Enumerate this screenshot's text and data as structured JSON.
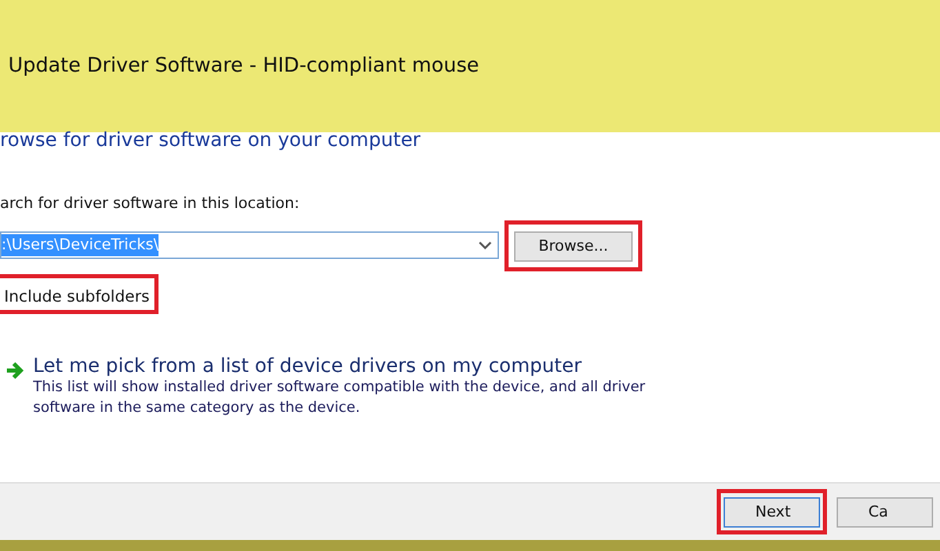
{
  "window": {
    "title": "Update Driver Software - HID-compliant mouse"
  },
  "heading": "rowse for driver software on your computer",
  "location": {
    "label": "arch for driver software in this location:",
    "value": ":\\Users\\DeviceTricks\\",
    "browse": {
      "label": "Browse...",
      "highlighted": true
    }
  },
  "subfolders": {
    "label": "Include subfolders",
    "highlighted": true
  },
  "option": {
    "title": "Let me pick from a list of device drivers on my computer",
    "description": "This list will show installed driver software compatible with the device, and all driver software in the same category as the device."
  },
  "buttons": [
    {
      "label": "Next",
      "highlighted": true,
      "focused": true
    },
    {
      "label": "Ca",
      "highlighted": false,
      "focused": false
    }
  ]
}
